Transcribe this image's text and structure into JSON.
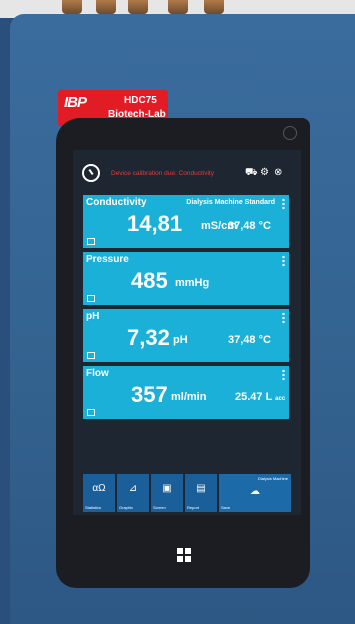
{
  "brand": {
    "logo": "IBP",
    "model": "HDC75",
    "subtitle": "Biotech-Lab"
  },
  "status": {
    "alert": "Device calibration due: Conductivity"
  },
  "panels": [
    {
      "title": "Conductivity",
      "standard": "Dialysis Machine Standard",
      "value": "14,81",
      "unit": "mS/cm",
      "temp": "37,48 °C"
    },
    {
      "title": "Pressure",
      "value": "485",
      "unit": "mmHg"
    },
    {
      "title": "pH",
      "value": "7,32",
      "unit": "pH",
      "temp": "37,48 °C"
    },
    {
      "title": "Flow",
      "value": "357",
      "unit": "ml/min",
      "temp": "25.47 L",
      "temp_suffix": "acc"
    }
  ],
  "toolbar": [
    {
      "label": "Statistics",
      "icon": "αΩ"
    },
    {
      "label": "Graphic",
      "icon": "chart-icon"
    },
    {
      "label": "Screen",
      "icon": "screen-icon"
    },
    {
      "label": "Report",
      "icon": "document-icon"
    },
    {
      "label": "Save",
      "top_label": "Dialysis Machine",
      "icon": "cloud-icon"
    }
  ],
  "colors": {
    "panel": "#1bb0d8",
    "alert": "#e53b3b",
    "brand": "#e11c24"
  }
}
